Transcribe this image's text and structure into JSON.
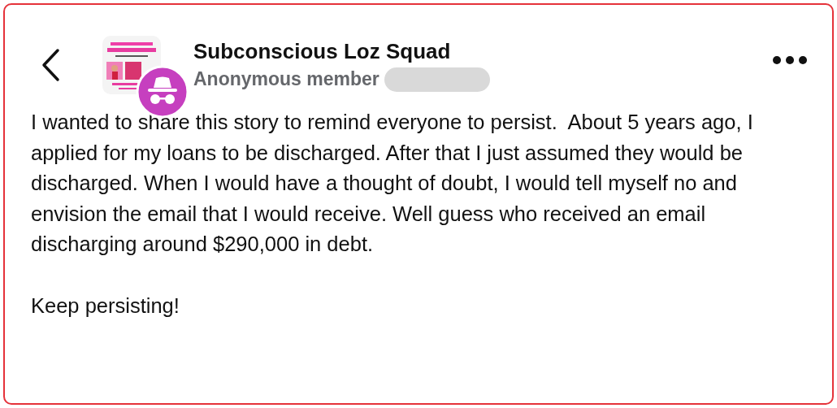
{
  "post": {
    "group_name": "Subconscious Loz Squad",
    "author": "Anonymous member",
    "paragraphs": [
      "I wanted to share this story to remind everyone to persist.  About 5 years ago, I applied for my loans to be discharged. After that I just assumed they would be discharged. When I would have a thought of doubt, I would tell myself no and envision the email that I would receive. Well guess who received an email discharging around $290,000 in debt.",
      "Keep persisting!"
    ]
  }
}
